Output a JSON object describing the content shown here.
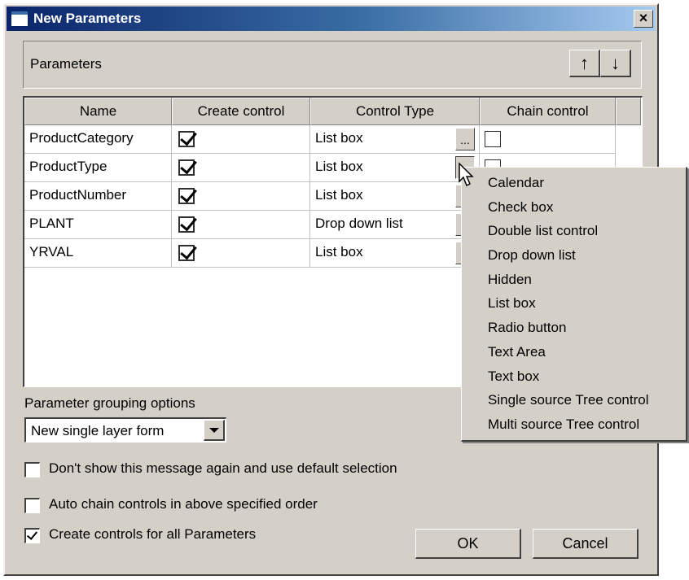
{
  "window": {
    "title": "New Parameters",
    "close_label": "×"
  },
  "parameters_group": {
    "label": "Parameters",
    "move_up_label": "↑",
    "move_down_label": "↓"
  },
  "grid": {
    "columns": [
      "Name",
      "Create control",
      "Control Type",
      "Chain control"
    ],
    "rows": [
      {
        "name": "ProductCategory",
        "create_control": true,
        "control_type": "List box",
        "chain_control": false
      },
      {
        "name": "ProductType",
        "create_control": true,
        "control_type": "List box",
        "chain_control": false
      },
      {
        "name": "ProductNumber",
        "create_control": true,
        "control_type": "List box",
        "chain_control": false
      },
      {
        "name": "PLANT",
        "create_control": true,
        "control_type": "Drop down list",
        "chain_control": false
      },
      {
        "name": "YRVAL",
        "create_control": true,
        "control_type": "List box",
        "chain_control": false
      }
    ],
    "ellipsis_label": "..."
  },
  "grouping": {
    "label": "Parameter grouping options",
    "selected": "New single layer form"
  },
  "options": {
    "dont_show": {
      "label": "Don't show this message again and use default selection",
      "checked": false
    },
    "auto_chain": {
      "label": "Auto chain controls in above specified order",
      "checked": false
    },
    "create_all": {
      "label": "Create controls for all Parameters",
      "checked": true
    }
  },
  "buttons": {
    "ok": "OK",
    "cancel": "Cancel"
  },
  "control_type_menu": [
    "Calendar",
    "Check box",
    "Double list control",
    "Drop down list",
    "Hidden",
    "List box",
    "Radio button",
    "Text Area",
    "Text box",
    "Single source Tree control",
    "Multi source Tree control"
  ]
}
